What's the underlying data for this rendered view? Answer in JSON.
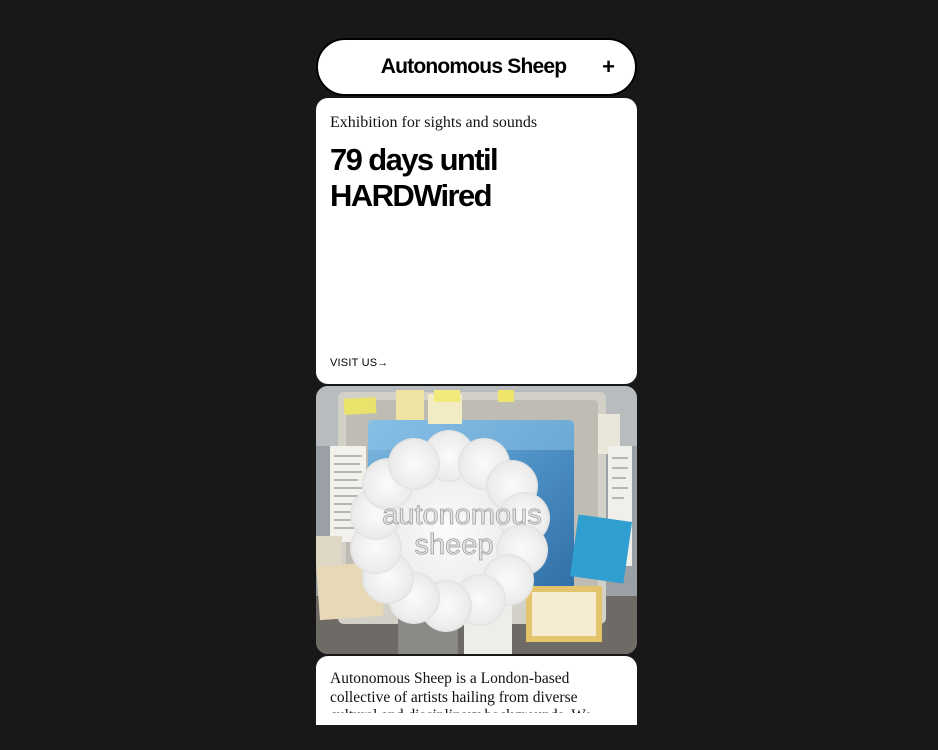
{
  "header": {
    "title": "Autonomous Sheep",
    "menu_icon": "plus-icon"
  },
  "hero": {
    "subtitle": "Exhibition for sights and sounds",
    "headline_line1": "79 days until",
    "headline_line2": "HARDWired",
    "visit_label": "VISIT US→"
  },
  "photo": {
    "logo_line1": "autonomous",
    "logo_line2": "sheep"
  },
  "about": {
    "text": "Autonomous Sheep is a London-based collective of artists hailing from diverse cultural and disciplinary backgrounds. We"
  },
  "colors": {
    "background": "#181818",
    "card": "#ffffff",
    "text": "#000000"
  }
}
